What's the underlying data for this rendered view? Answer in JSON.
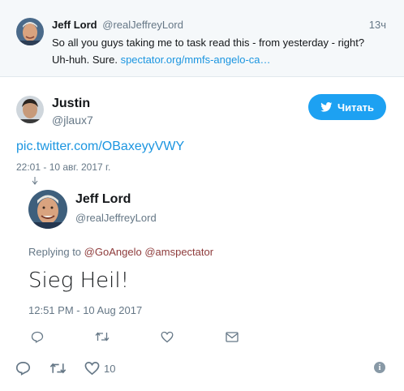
{
  "parent_tweet": {
    "name": "Jeff Lord",
    "handle": "@realJeffreyLord",
    "time": "13ч",
    "text": "So all you guys taking me to task read this - from yesterday - right? Uh-huh. Sure.",
    "link": "spectator.org/mmfs-angelo-ca…"
  },
  "main_tweet": {
    "name": "Justin",
    "handle": "@jlaux7",
    "follow_label": "Читать",
    "link": "pic.twitter.com/OBaxeyyVWY",
    "date": "22:01 - 10 авг. 2017 г."
  },
  "quoted_tweet": {
    "name": "Jeff Lord",
    "handle": "@realJeffreyLord",
    "replying_prefix": "Replying to",
    "replying_to_1": "@GoAngelo",
    "replying_to_2": "@amspectator",
    "text": "Sieg Heil!",
    "date": "12:51 PM - 10 Aug 2017"
  },
  "actions": {
    "like_count": "10"
  },
  "colors": {
    "accent": "#1da1f2",
    "link": "#1b95e0",
    "muted": "#657786",
    "reply_link": "#8e3b3b",
    "parent_bg": "#f5f8fa"
  },
  "icons": [
    "reply-icon",
    "retweet-icon",
    "heart-icon",
    "message-icon",
    "info-icon",
    "twitter-bird-icon"
  ]
}
